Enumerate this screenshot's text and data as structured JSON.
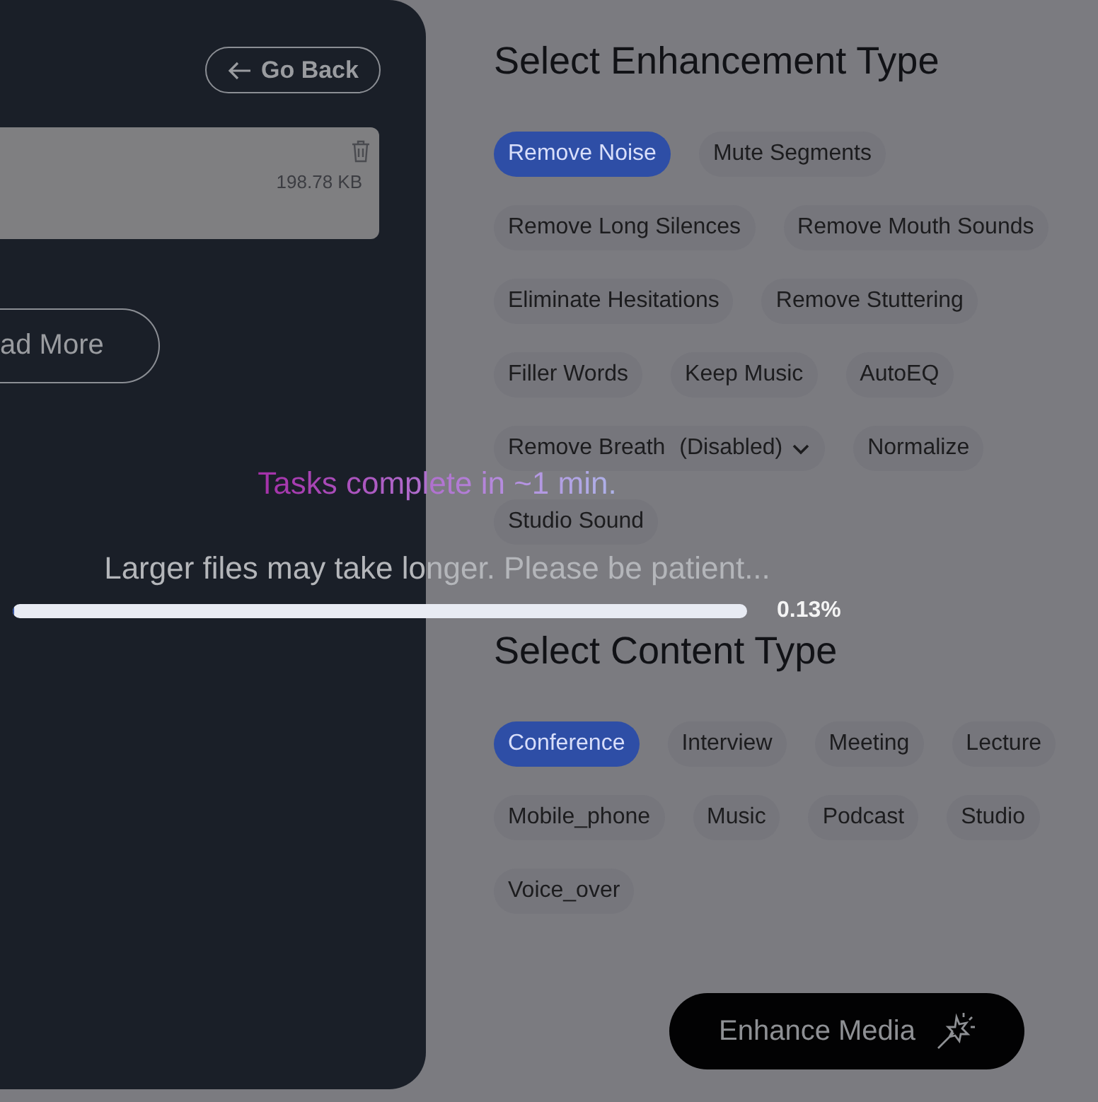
{
  "side_panel": {
    "back_button": "Go Back",
    "file": {
      "size": "198.78 KB"
    },
    "more_button": "ad More"
  },
  "enhancement": {
    "title": "Select Enhancement Type",
    "options": [
      {
        "label": "Remove Noise",
        "kind": "chip",
        "selected": true
      },
      {
        "label": "Mute Segments",
        "kind": "chip",
        "selected": false
      },
      {
        "label": "Remove Long Silences",
        "kind": "chip",
        "selected": false
      },
      {
        "label": "Remove Mouth Sounds",
        "kind": "chip",
        "selected": false
      },
      {
        "label": "Eliminate Hesitations",
        "kind": "chip",
        "selected": false
      },
      {
        "label": "Remove Stuttering",
        "kind": "chip",
        "selected": false
      },
      {
        "label": "Filler Words",
        "kind": "chip",
        "selected": false
      },
      {
        "label": "Keep Music",
        "kind": "chip",
        "selected": false
      },
      {
        "label": "AutoEQ",
        "kind": "chip",
        "selected": false
      },
      {
        "label": "Remove Breath",
        "note": "(Disabled)",
        "kind": "dropdown",
        "selected": false
      },
      {
        "label": "Normalize",
        "kind": "chip",
        "selected": false
      },
      {
        "label": "Studio Sound",
        "kind": "chip",
        "selected": false
      }
    ]
  },
  "content": {
    "title": "Select Content Type",
    "options": [
      {
        "label": "Conference",
        "kind": "chip",
        "selected": true
      },
      {
        "label": "Interview",
        "kind": "chip",
        "selected": false
      },
      {
        "label": "Meeting",
        "kind": "chip",
        "selected": false
      },
      {
        "label": "Lecture",
        "kind": "chip",
        "selected": false
      },
      {
        "label": "Mobile_phone",
        "kind": "chip",
        "selected": false
      },
      {
        "label": "Music",
        "kind": "chip",
        "selected": false
      },
      {
        "label": "Podcast",
        "kind": "chip",
        "selected": false
      },
      {
        "label": "Studio",
        "kind": "chip",
        "selected": false
      },
      {
        "label": "Voice_over",
        "kind": "chip",
        "selected": false
      }
    ]
  },
  "enhance_button": "Enhance Media",
  "progress": {
    "title": "Tasks complete in ~1 min.",
    "message": "Larger files may take longer. Please be patient...",
    "level": 0.0013,
    "reading": "0.13%"
  }
}
